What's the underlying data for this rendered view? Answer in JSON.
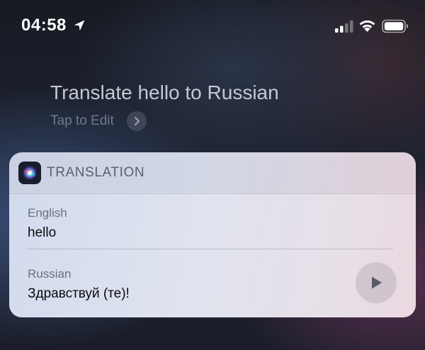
{
  "status_bar": {
    "time": "04:58",
    "location_icon": "location-arrow-icon",
    "signal_icon": "cellular-signal-icon",
    "wifi_icon": "wifi-icon",
    "battery_icon": "battery-icon"
  },
  "query": {
    "text": "Translate hello to Russian",
    "edit_label": "Tap to Edit",
    "edit_icon": "chevron-right-icon"
  },
  "card": {
    "title": "TRANSLATION",
    "app_icon": "siri-icon",
    "source": {
      "language": "English",
      "text": "hello"
    },
    "target": {
      "language": "Russian",
      "text": "Здравствуй (те)!"
    },
    "play_icon": "play-icon"
  },
  "colors": {
    "card_header": "#c8cfe0",
    "card_body": "#dfe3ee",
    "query_text": "#c3c8d4",
    "muted_text": "#6f7a8e"
  }
}
